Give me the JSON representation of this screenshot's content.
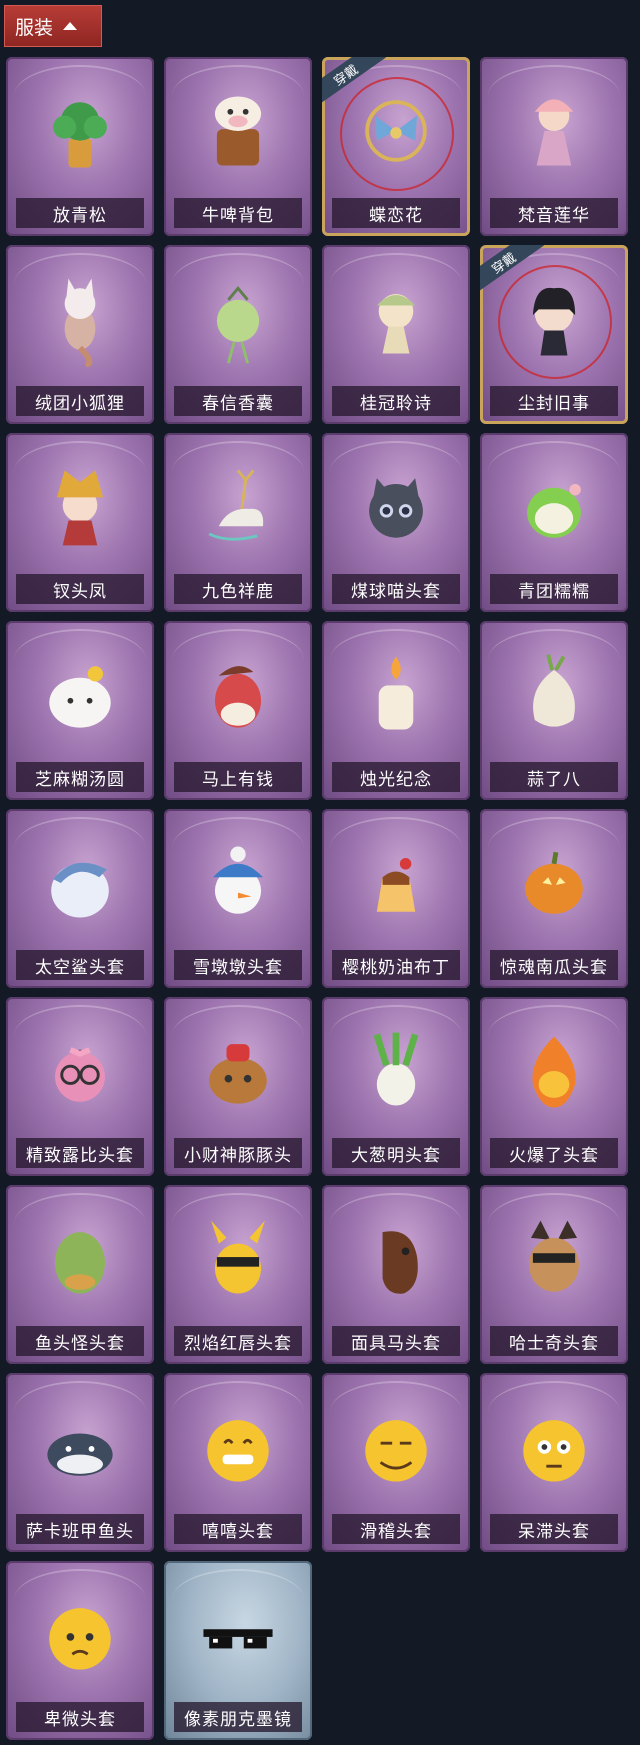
{
  "header": {
    "title": "服装",
    "icon": "chevron-up-icon"
  },
  "colors": {
    "header_bg": "#a8322d",
    "card_bg": "#9c73ae",
    "worn_border": "#caa45a",
    "page_bg": "#131a26"
  },
  "items": [
    {
      "label": "放青松",
      "icon": "potted-pine-icon",
      "worn": false,
      "variant": "purple"
    },
    {
      "label": "牛啤背包",
      "icon": "cow-beer-backpack-icon",
      "worn": false,
      "variant": "purple"
    },
    {
      "label": "蝶恋花",
      "icon": "butterfly-flower-ornament-icon",
      "worn": true,
      "badge": "穿戴",
      "variant": "purple"
    },
    {
      "label": "梵音莲华",
      "icon": "lotus-doll-icon",
      "worn": false,
      "variant": "purple"
    },
    {
      "label": "绒团小狐狸",
      "icon": "fox-plush-icon",
      "worn": false,
      "variant": "purple"
    },
    {
      "label": "春信香囊",
      "icon": "sachet-icon",
      "worn": false,
      "variant": "purple"
    },
    {
      "label": "桂冠聆诗",
      "icon": "laurel-doll-icon",
      "worn": false,
      "variant": "purple"
    },
    {
      "label": "尘封旧事",
      "icon": "dark-hair-doll-icon",
      "worn": true,
      "badge": "穿戴",
      "variant": "purple"
    },
    {
      "label": "钗头凤",
      "icon": "phoenix-crown-doll-icon",
      "worn": false,
      "variant": "purple"
    },
    {
      "label": "九色祥鹿",
      "icon": "deer-icon",
      "worn": false,
      "variant": "purple"
    },
    {
      "label": "煤球喵头套",
      "icon": "black-cat-head-icon",
      "worn": false,
      "variant": "purple"
    },
    {
      "label": "青团糯糯",
      "icon": "green-dumpling-icon",
      "worn": false,
      "variant": "purple"
    },
    {
      "label": "芝麻糊汤圆",
      "icon": "rice-ball-icon",
      "worn": false,
      "variant": "purple"
    },
    {
      "label": "马上有钱",
      "icon": "red-horse-head-icon",
      "worn": false,
      "variant": "purple"
    },
    {
      "label": "烛光纪念",
      "icon": "candle-icon",
      "worn": false,
      "variant": "purple"
    },
    {
      "label": "蒜了八",
      "icon": "garlic-icon",
      "worn": false,
      "variant": "purple"
    },
    {
      "label": "太空鲨头套",
      "icon": "shark-head-icon",
      "worn": false,
      "variant": "purple"
    },
    {
      "label": "雪墩墩头套",
      "icon": "snowman-head-icon",
      "worn": false,
      "variant": "purple"
    },
    {
      "label": "樱桃奶油布丁",
      "icon": "pudding-icon",
      "worn": false,
      "variant": "purple"
    },
    {
      "label": "惊魂南瓜头套",
      "icon": "pumpkin-icon",
      "worn": false,
      "variant": "purple"
    },
    {
      "label": "精致露比头套",
      "icon": "pink-glasses-head-icon",
      "worn": false,
      "variant": "purple"
    },
    {
      "label": "小财神豚豚头",
      "icon": "capybara-head-icon",
      "worn": false,
      "variant": "purple"
    },
    {
      "label": "大葱明头套",
      "icon": "scallion-head-icon",
      "worn": false,
      "variant": "purple"
    },
    {
      "label": "火爆了头套",
      "icon": "fire-face-icon",
      "worn": false,
      "variant": "purple"
    },
    {
      "label": "鱼头怪头套",
      "icon": "fish-head-icon",
      "worn": false,
      "variant": "purple"
    },
    {
      "label": "烈焰红唇头套",
      "icon": "yellow-sunglasses-head-icon",
      "worn": false,
      "variant": "purple"
    },
    {
      "label": "面具马头套",
      "icon": "horse-mask-icon",
      "worn": false,
      "variant": "purple"
    },
    {
      "label": "哈士奇头套",
      "icon": "husky-sunglasses-icon",
      "worn": false,
      "variant": "purple"
    },
    {
      "label": "萨卡班甲鱼头",
      "icon": "sacabambaspis-head-icon",
      "worn": false,
      "variant": "purple"
    },
    {
      "label": "嘻嘻头套",
      "icon": "grin-emoji-icon",
      "worn": false,
      "variant": "purple"
    },
    {
      "label": "滑稽头套",
      "icon": "smirk-emoji-icon",
      "worn": false,
      "variant": "purple"
    },
    {
      "label": "呆滞头套",
      "icon": "dazed-emoji-icon",
      "worn": false,
      "variant": "purple"
    },
    {
      "label": "卑微头套",
      "icon": "pleading-emoji-icon",
      "worn": false,
      "variant": "purple"
    },
    {
      "label": "像素朋克墨镜",
      "icon": "pixel-sunglasses-icon",
      "worn": false,
      "variant": "silver"
    }
  ]
}
